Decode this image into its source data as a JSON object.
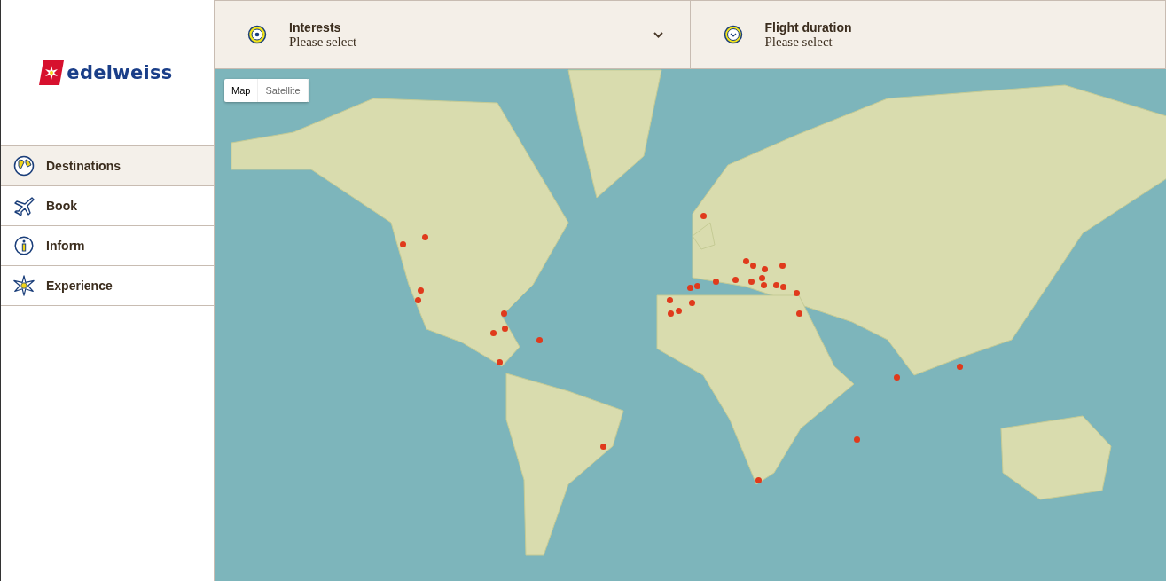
{
  "logo": {
    "text": "edelweiss"
  },
  "nav": [
    {
      "label": "Destinations",
      "selected": true
    },
    {
      "label": "Book",
      "selected": false
    },
    {
      "label": "Inform",
      "selected": false
    },
    {
      "label": "Experience",
      "selected": false
    }
  ],
  "filters": [
    {
      "label": "Interests",
      "value": "Please select",
      "dropdown": true
    },
    {
      "label": "Flight duration",
      "value": "Please select",
      "dropdown": false
    }
  ],
  "map": {
    "types": [
      {
        "label": "Map",
        "selected": true
      },
      {
        "label": "Satellite",
        "selected": false
      }
    ]
  }
}
